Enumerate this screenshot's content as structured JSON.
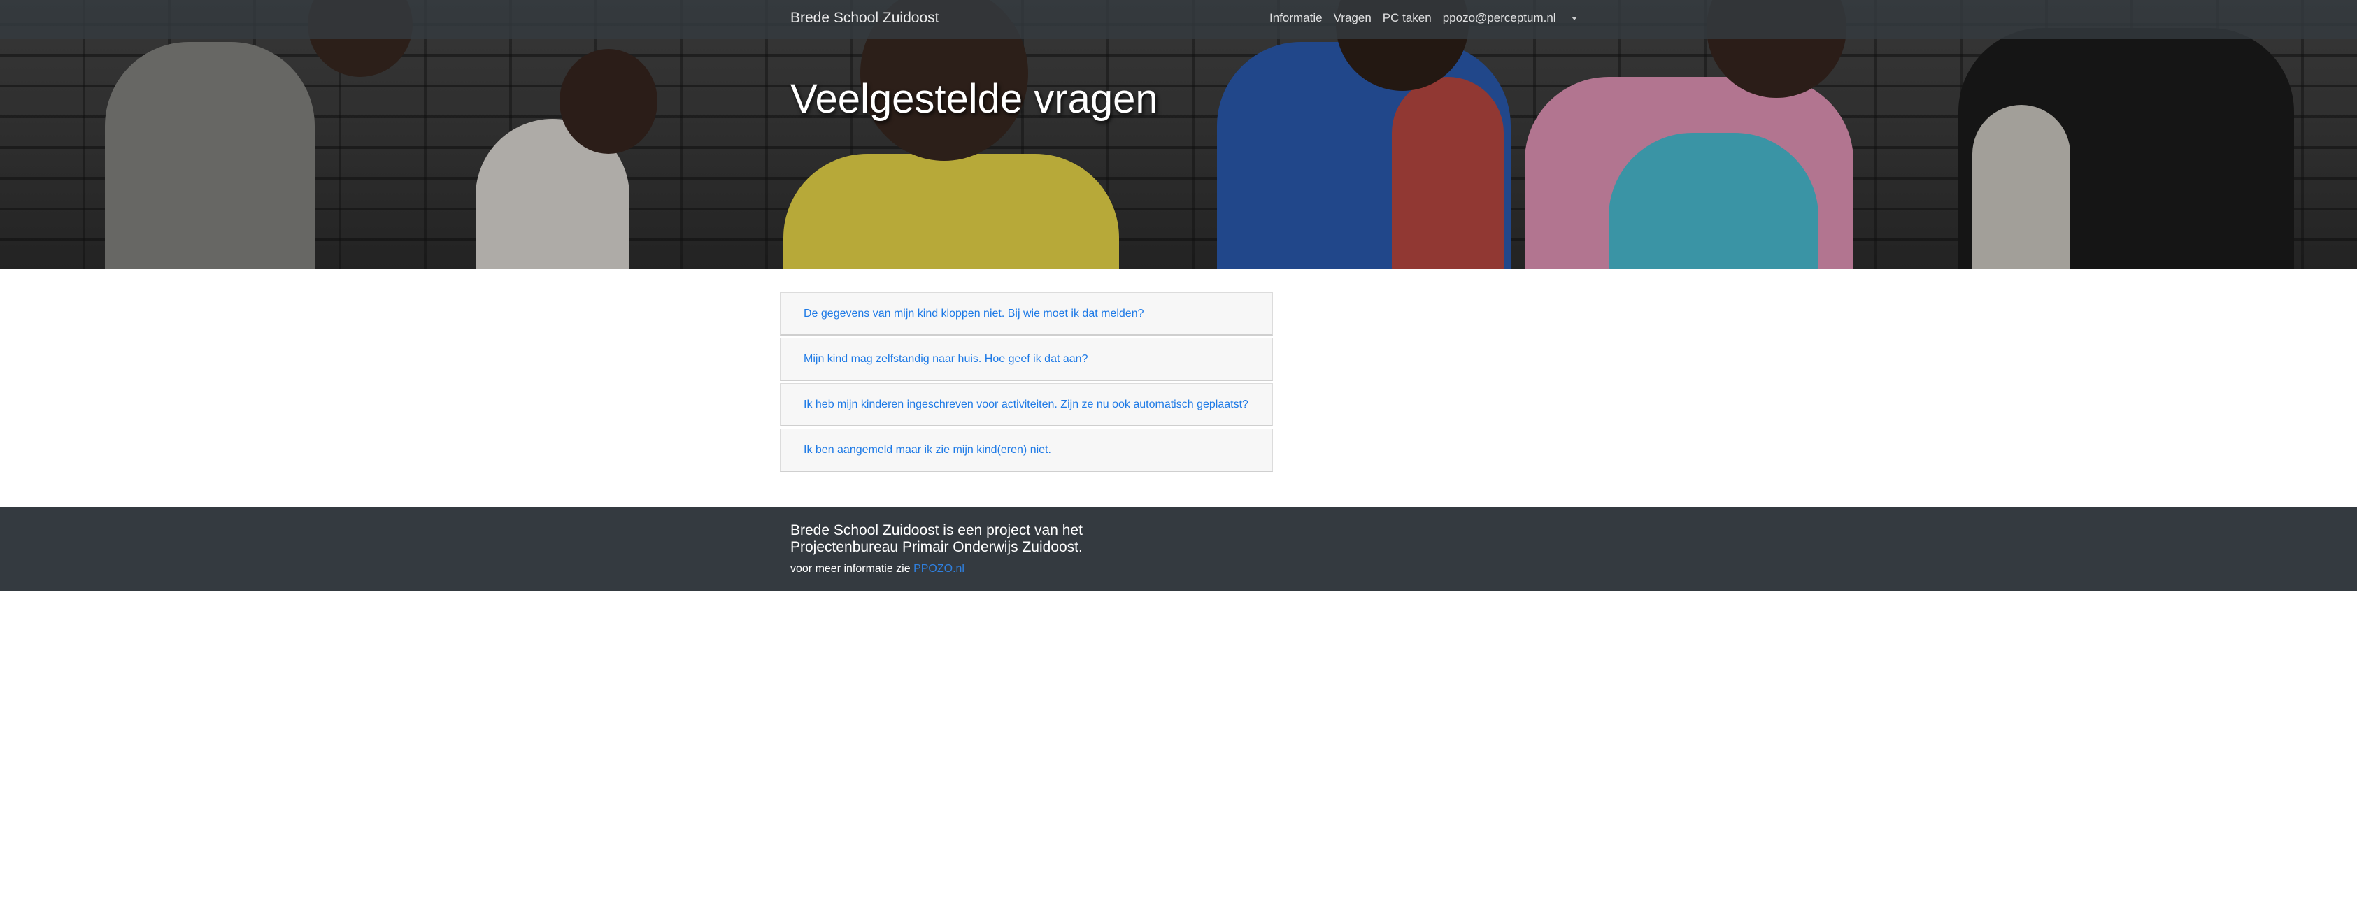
{
  "navbar": {
    "brand": "Brede School Zuidoost",
    "links": [
      "Informatie",
      "Vragen",
      "PC taken",
      "ppozo@perceptum.nl"
    ]
  },
  "hero": {
    "title": "Veelgestelde vragen"
  },
  "faq": {
    "items": [
      "De gegevens van mijn kind kloppen niet. Bij wie moet ik dat melden?",
      "Mijn kind mag zelfstandig naar huis. Hoe geef ik dat aan?",
      "Ik heb mijn kinderen ingeschreven voor activiteiten. Zijn ze nu ook automatisch geplaatst?",
      "Ik ben aangemeld maar ik zie mijn kind(eren) niet."
    ]
  },
  "footer": {
    "title": "Brede School Zuidoost is een project van het Projectenbureau Primair Onderwijs Zuidoost.",
    "sub_prefix": "voor meer informatie zie",
    "link": "PPOZO.nl"
  },
  "colors": {
    "navbar": "#343a40",
    "link": "#1e7ae6",
    "footer": "#343a40"
  }
}
